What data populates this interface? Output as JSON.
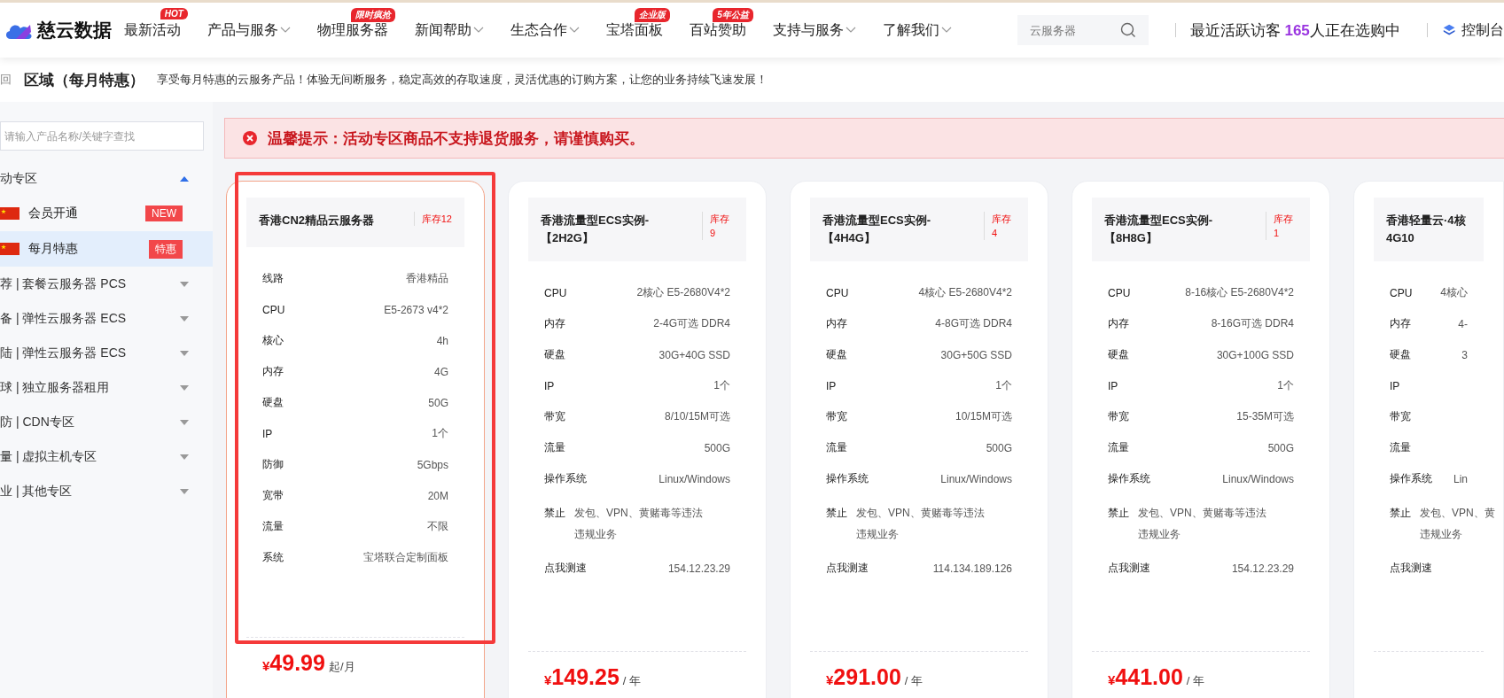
{
  "header": {
    "logo_text": "慈云数据",
    "nav": [
      {
        "label": "最新活动",
        "badge": "HOT",
        "dropdown": false
      },
      {
        "label": "产品与服务",
        "dropdown": true
      },
      {
        "label": "物理服务器",
        "badge": "限时疯抢",
        "dropdown": false
      },
      {
        "label": "新闻帮助",
        "dropdown": true
      },
      {
        "label": "生态合作",
        "dropdown": true
      },
      {
        "label": "宝塔面板",
        "badge": "企业版",
        "dropdown": false
      },
      {
        "label": "百站赞助",
        "badge": "5年公益",
        "dropdown": false
      },
      {
        "label": "支持与服务",
        "dropdown": true
      },
      {
        "label": "了解我们",
        "dropdown": true
      }
    ],
    "search": {
      "placeholder": "云服务器"
    },
    "visitors": {
      "prefix": "最近活跃访客",
      "count": "165",
      "suffix": "人正在选购中"
    },
    "console": "控制台"
  },
  "subheader": {
    "back": "回",
    "title": "区域（每月特惠）",
    "description": "享受每月特惠的云服务产品！体验无间断服务，稳定高效的存取速度，灵活优惠的订购方案，让您的业务持续飞速发展！"
  },
  "sidebar": {
    "search": {
      "placeholder": "请输入产品名称/关键字查找"
    },
    "groups": [
      {
        "label": "动专区",
        "expanded": true,
        "children": [
          {
            "label": "会员开通",
            "tag": "NEW",
            "selected": false
          },
          {
            "label": "每月特惠",
            "tag": "特惠",
            "selected": true
          }
        ]
      },
      {
        "label": "荐 | 套餐云服务器 PCS",
        "expanded": false
      },
      {
        "label": "备 | 弹性云服务器 ECS",
        "expanded": false
      },
      {
        "label": "陆 | 弹性云服务器 ECS",
        "expanded": false
      },
      {
        "label": "球 | 独立服务器租用",
        "expanded": false
      },
      {
        "label": "防 | CDN专区",
        "expanded": false
      },
      {
        "label": "量 | 虚拟主机专区",
        "expanded": false
      },
      {
        "label": "业 | 其他专区",
        "expanded": false
      }
    ]
  },
  "alert": "温馨提示：活动专区商品不支持退货服务，请谨慎购买。",
  "cards": [
    {
      "title": "香港CN2精品云服务器",
      "stock_label": "库存",
      "stock": "12",
      "selected": true,
      "specs": [
        {
          "kind": "spec",
          "label": "线路",
          "value": "香港精品"
        },
        {
          "kind": "spec",
          "label": "CPU",
          "value": "E5-2673 v4*2"
        },
        {
          "kind": "spec",
          "label": "核心",
          "value": "4h"
        },
        {
          "kind": "spec",
          "label": "内存",
          "value": "4G"
        },
        {
          "kind": "spec",
          "label": "硬盘",
          "value": "50G"
        },
        {
          "kind": "spec",
          "label": "IP",
          "value": "1个"
        },
        {
          "kind": "spec",
          "label": "防御",
          "value": "5Gbps"
        },
        {
          "kind": "spec",
          "label": "宽带",
          "value": "20M"
        },
        {
          "kind": "spec",
          "label": "流量",
          "value": "不限"
        },
        {
          "kind": "spec",
          "label": "系统",
          "value": "宝塔联合定制面板"
        }
      ],
      "price": {
        "currency": "¥",
        "amount": "49.99",
        "unit": "起/月"
      }
    },
    {
      "title": "香港流量型ECS实例-【2H2G】",
      "stock_label": "库存",
      "stock": "9",
      "selected": false,
      "specs": [
        {
          "kind": "spec",
          "label": "CPU",
          "value": "2核心 E5-2680V4*2"
        },
        {
          "kind": "spec",
          "label": "内存",
          "value": "2-4G可选 DDR4"
        },
        {
          "kind": "spec",
          "label": "硬盘",
          "value": "30G+40G SSD"
        },
        {
          "kind": "spec",
          "label": "IP",
          "value": "1个"
        },
        {
          "kind": "spec",
          "label": "带宽",
          "value": "8/10/15M可选"
        },
        {
          "kind": "spec",
          "label": "流量",
          "value": "500G"
        },
        {
          "kind": "spec",
          "label": "操作系统",
          "value": "Linux/Windows"
        },
        {
          "kind": "note",
          "label": "禁止",
          "lines": [
            "发包、VPN、黄赌毒等违法",
            "违规业务"
          ]
        },
        {
          "kind": "spec",
          "label": "点我测速",
          "value": "154.12.23.29"
        }
      ],
      "price": {
        "currency": "¥",
        "amount": "149.25",
        "unit": "/ 年"
      }
    },
    {
      "title": "香港流量型ECS实例-【4H4G】",
      "stock_label": "库存",
      "stock": "4",
      "selected": false,
      "specs": [
        {
          "kind": "spec",
          "label": "CPU",
          "value": "4核心 E5-2680V4*2"
        },
        {
          "kind": "spec",
          "label": "内存",
          "value": "4-8G可选 DDR4"
        },
        {
          "kind": "spec",
          "label": "硬盘",
          "value": "30G+50G SSD"
        },
        {
          "kind": "spec",
          "label": "IP",
          "value": "1个"
        },
        {
          "kind": "spec",
          "label": "带宽",
          "value": "10/15M可选"
        },
        {
          "kind": "spec",
          "label": "流量",
          "value": "500G"
        },
        {
          "kind": "spec",
          "label": "操作系统",
          "value": "Linux/Windows"
        },
        {
          "kind": "note",
          "label": "禁止",
          "lines": [
            "发包、VPN、黄赌毒等违法",
            "违规业务"
          ]
        },
        {
          "kind": "spec",
          "label": "点我测速",
          "value": "114.134.189.126"
        }
      ],
      "price": {
        "currency": "¥",
        "amount": "291.00",
        "unit": "/ 年"
      }
    },
    {
      "title": "香港流量型ECS实例-【8H8G】",
      "stock_label": "库存",
      "stock": "1",
      "selected": false,
      "specs": [
        {
          "kind": "spec",
          "label": "CPU",
          "value": "8-16核心 E5-2680V4*2"
        },
        {
          "kind": "spec",
          "label": "内存",
          "value": "8-16G可选 DDR4"
        },
        {
          "kind": "spec",
          "label": "硬盘",
          "value": "30G+100G SSD"
        },
        {
          "kind": "spec",
          "label": "IP",
          "value": "1个"
        },
        {
          "kind": "spec",
          "label": "带宽",
          "value": "15-35M可选"
        },
        {
          "kind": "spec",
          "label": "流量",
          "value": "500G"
        },
        {
          "kind": "spec",
          "label": "操作系统",
          "value": "Linux/Windows"
        },
        {
          "kind": "note",
          "label": "禁止",
          "lines": [
            "发包、VPN、黄赌毒等违法",
            "违规业务"
          ]
        },
        {
          "kind": "spec",
          "label": "点我测速",
          "value": "154.12.23.29"
        }
      ],
      "price": {
        "currency": "¥",
        "amount": "441.00",
        "unit": "/ 年"
      }
    },
    {
      "title": "香港轻量云·4核4G10",
      "selected": false,
      "specs": [
        {
          "kind": "spec",
          "label": "CPU",
          "value": "4核心"
        },
        {
          "kind": "spec",
          "label": "内存",
          "value": "4-"
        },
        {
          "kind": "spec",
          "label": "硬盘",
          "value": "3"
        },
        {
          "kind": "spec",
          "label": "IP"
        },
        {
          "kind": "spec",
          "label": "带宽"
        },
        {
          "kind": "spec",
          "label": "流量"
        },
        {
          "kind": "spec",
          "label": "操作系统",
          "value": "Lin"
        },
        {
          "kind": "note",
          "label": "禁止",
          "lines": [
            "发包、VPN、黄",
            "违规业务"
          ]
        },
        {
          "kind": "spec",
          "label": "点我测速"
        }
      ]
    }
  ]
}
